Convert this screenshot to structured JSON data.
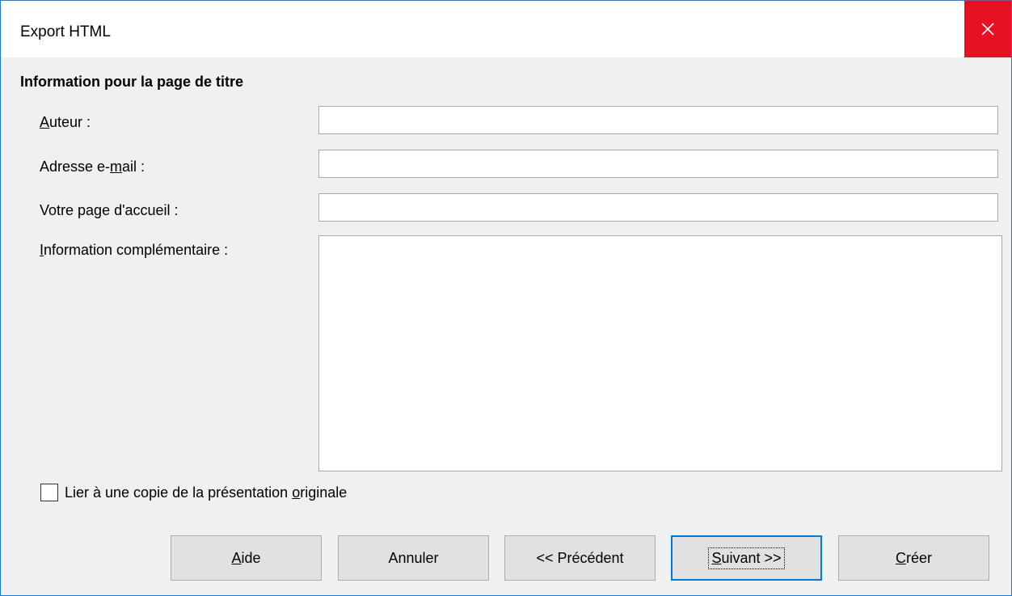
{
  "window": {
    "title": "Export HTML",
    "close_icon": "close-icon"
  },
  "section": {
    "heading": "Information pour la page de titre"
  },
  "fields": {
    "author": {
      "label_mnemonic": "A",
      "label_rest": "uteur :",
      "value": ""
    },
    "email": {
      "label_prefix": "Adresse e-",
      "label_mnemonic": "m",
      "label_rest": "ail :",
      "value": ""
    },
    "homepage": {
      "label": "Votre page d'accueil :",
      "value": ""
    },
    "info": {
      "label_mnemonic": "I",
      "label_rest": "nformation complémentaire :",
      "value": ""
    }
  },
  "checkbox": {
    "label_prefix": "Lier à une copie de la présentation ",
    "label_mnemonic": "o",
    "label_rest": "riginale",
    "checked": false
  },
  "buttons": {
    "help": {
      "mnemonic": "A",
      "rest": "ide"
    },
    "cancel": {
      "label": "Annuler"
    },
    "previous": {
      "label": "<< Précédent"
    },
    "next": {
      "mnemonic": "S",
      "rest": "uivant >>"
    },
    "create": {
      "mnemonic": "C",
      "rest": "réer"
    }
  },
  "colors": {
    "window_border": "#1c7ad6",
    "close_button": "#e81123",
    "default_button_border": "#0078d7",
    "dialog_background": "#f0f0f0"
  }
}
